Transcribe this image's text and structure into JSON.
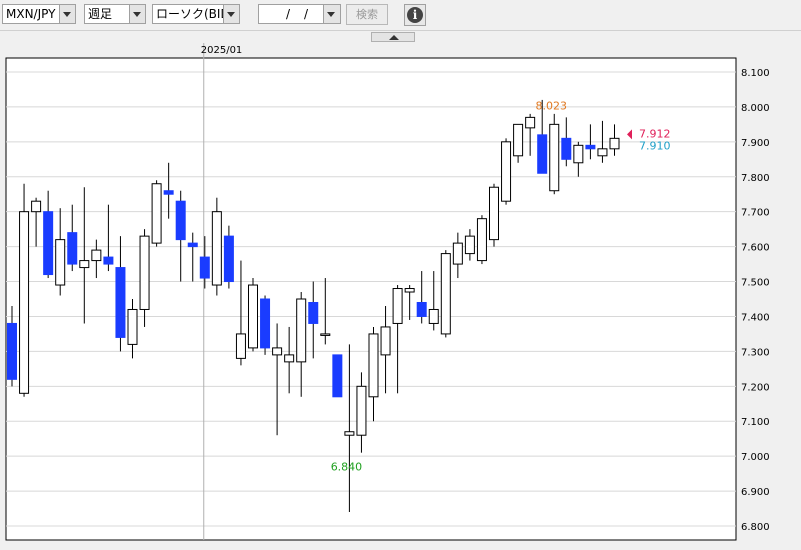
{
  "toolbar": {
    "pair": "MXN/JPY",
    "period": "週足",
    "chart_kind": "ローソク(BID)",
    "date_sep1": "/",
    "date_sep2": "/",
    "search_label": "検索",
    "info_icon": "i"
  },
  "colors": {
    "bull": "#ffffff",
    "bear": "#1a3cff",
    "wick": "#000000",
    "high_label": "#e07820",
    "low_label": "#20a020",
    "bid_label": "#e0205a",
    "ask_label": "#20a0c8"
  },
  "chart_data": {
    "type": "candlestick",
    "ylim": [
      6.76,
      8.14
    ],
    "yticks": [
      "6.800",
      "6.900",
      "7.000",
      "7.100",
      "7.200",
      "7.300",
      "7.400",
      "7.500",
      "7.600",
      "7.700",
      "7.800",
      "7.900",
      "8.000",
      "8.100"
    ],
    "date_label": "2025/01",
    "date_label_index": 15,
    "high_label": "8.023",
    "high_index": 46,
    "low_label": "6.840",
    "low_index": 29,
    "bid_label": "7.912",
    "ask_label": "7.910",
    "candles": [
      [
        7.38,
        7.43,
        7.2,
        7.22
      ],
      [
        7.18,
        7.78,
        7.17,
        7.7
      ],
      [
        7.7,
        7.74,
        7.6,
        7.73
      ],
      [
        7.7,
        7.76,
        7.51,
        7.52
      ],
      [
        7.49,
        7.71,
        7.46,
        7.62
      ],
      [
        7.64,
        7.72,
        7.53,
        7.55
      ],
      [
        7.54,
        7.77,
        7.38,
        7.56
      ],
      [
        7.56,
        7.62,
        7.51,
        7.59
      ],
      [
        7.57,
        7.72,
        7.53,
        7.55
      ],
      [
        7.54,
        7.63,
        7.3,
        7.34
      ],
      [
        7.32,
        7.45,
        7.28,
        7.42
      ],
      [
        7.42,
        7.65,
        7.37,
        7.63
      ],
      [
        7.61,
        7.79,
        7.6,
        7.78
      ],
      [
        7.76,
        7.84,
        7.68,
        7.75
      ],
      [
        7.73,
        7.76,
        7.5,
        7.62
      ],
      [
        7.61,
        7.64,
        7.5,
        7.6
      ],
      [
        7.57,
        7.63,
        7.48,
        7.51
      ],
      [
        7.49,
        7.74,
        7.46,
        7.7
      ],
      [
        7.63,
        7.66,
        7.48,
        7.5
      ],
      [
        7.28,
        7.56,
        7.26,
        7.35
      ],
      [
        7.31,
        7.51,
        7.3,
        7.49
      ],
      [
        7.45,
        7.46,
        7.29,
        7.31
      ],
      [
        7.29,
        7.38,
        7.06,
        7.31
      ],
      [
        7.27,
        7.37,
        7.18,
        7.29
      ],
      [
        7.27,
        7.47,
        7.17,
        7.45
      ],
      [
        7.44,
        7.5,
        7.28,
        7.38
      ],
      [
        7.35,
        7.51,
        7.32,
        7.35
      ],
      [
        7.29,
        7.29,
        7.2,
        7.17
      ],
      [
        7.06,
        7.32,
        6.84,
        7.07
      ],
      [
        7.06,
        7.24,
        7.01,
        7.2
      ],
      [
        7.17,
        7.37,
        7.1,
        7.35
      ],
      [
        7.29,
        7.43,
        7.18,
        7.37
      ],
      [
        7.38,
        7.49,
        7.18,
        7.48
      ],
      [
        7.47,
        7.49,
        7.39,
        7.48
      ],
      [
        7.44,
        7.53,
        7.38,
        7.4
      ],
      [
        7.38,
        7.53,
        7.36,
        7.42
      ],
      [
        7.35,
        7.59,
        7.34,
        7.58
      ],
      [
        7.55,
        7.64,
        7.51,
        7.61
      ],
      [
        7.58,
        7.65,
        7.56,
        7.63
      ],
      [
        7.56,
        7.69,
        7.55,
        7.68
      ],
      [
        7.62,
        7.78,
        7.6,
        7.77
      ],
      [
        7.73,
        7.91,
        7.72,
        7.9
      ],
      [
        7.86,
        7.95,
        7.84,
        7.95
      ],
      [
        7.94,
        7.98,
        7.86,
        7.97
      ],
      [
        7.92,
        8.02,
        7.81,
        7.81
      ],
      [
        7.76,
        7.98,
        7.75,
        7.95
      ],
      [
        7.91,
        7.97,
        7.83,
        7.85
      ],
      [
        7.84,
        7.9,
        7.8,
        7.89
      ],
      [
        7.89,
        7.95,
        7.85,
        7.88
      ],
      [
        7.86,
        7.96,
        7.84,
        7.88
      ],
      [
        7.88,
        7.95,
        7.86,
        7.91
      ]
    ]
  }
}
